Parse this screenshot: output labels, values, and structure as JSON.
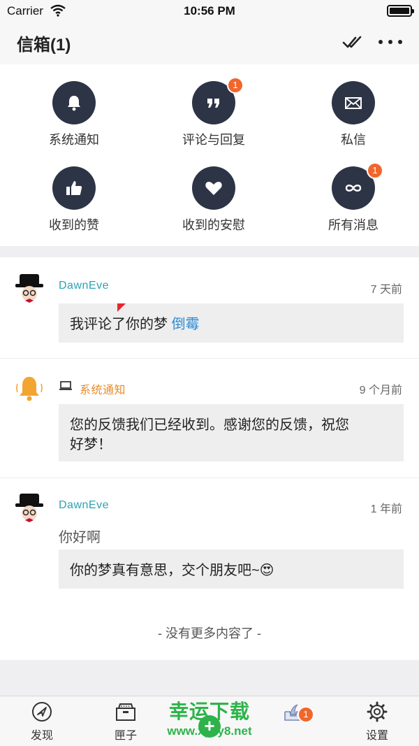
{
  "status_bar": {
    "carrier": "Carrier",
    "time": "10:56 PM"
  },
  "nav": {
    "title": "信箱(1)",
    "mark_read_icon": "double-check-icon",
    "more_icon": "more-dots-icon"
  },
  "categories": [
    {
      "label": "系统通知",
      "icon": "bell-icon",
      "badge": ""
    },
    {
      "label": "评论与回复",
      "icon": "quote-icon",
      "badge": "1"
    },
    {
      "label": "私信",
      "icon": "envelope-icon",
      "badge": ""
    },
    {
      "label": "收到的赞",
      "icon": "thumbs-up-icon",
      "badge": ""
    },
    {
      "label": "收到的安慰",
      "icon": "heart-icon",
      "badge": ""
    },
    {
      "label": "所有消息",
      "icon": "infinity-icon",
      "badge": "1"
    }
  ],
  "messages": [
    {
      "sender": "DawnEve",
      "time": "7 天前",
      "text": "我评论了你的梦 ",
      "link": "倒霉",
      "unread": true
    },
    {
      "sender": "系统通知",
      "time": "9 个月前",
      "text_line1": "您的反馈我们已经收到。感谢您的反馈，祝您",
      "text_line2": "好梦！"
    },
    {
      "sender": "DawnEve",
      "time": "1 年前",
      "subtext": "你好啊",
      "text": "你的梦真有意思，交个朋友吧~😍"
    }
  ],
  "no_more": "- 没有更多内容了 -",
  "tabs": [
    {
      "label": "发现",
      "icon": "compass-icon"
    },
    {
      "label": "匣子",
      "icon": "box-icon"
    },
    {
      "label": "",
      "icon": "add-icon"
    },
    {
      "label": "",
      "icon": "inbox-icon",
      "badge": "1"
    },
    {
      "label": "设置",
      "icon": "gear-icon"
    }
  ],
  "watermark": {
    "line1": "幸运下载",
    "line2": "www.xyxy8.net"
  },
  "colors": {
    "accent_dark": "#2d3446",
    "badge": "#f2662b",
    "username": "#2aa3b3",
    "system": "#e68a2b",
    "link": "#2c8bd4",
    "watermark": "#2db34a"
  }
}
